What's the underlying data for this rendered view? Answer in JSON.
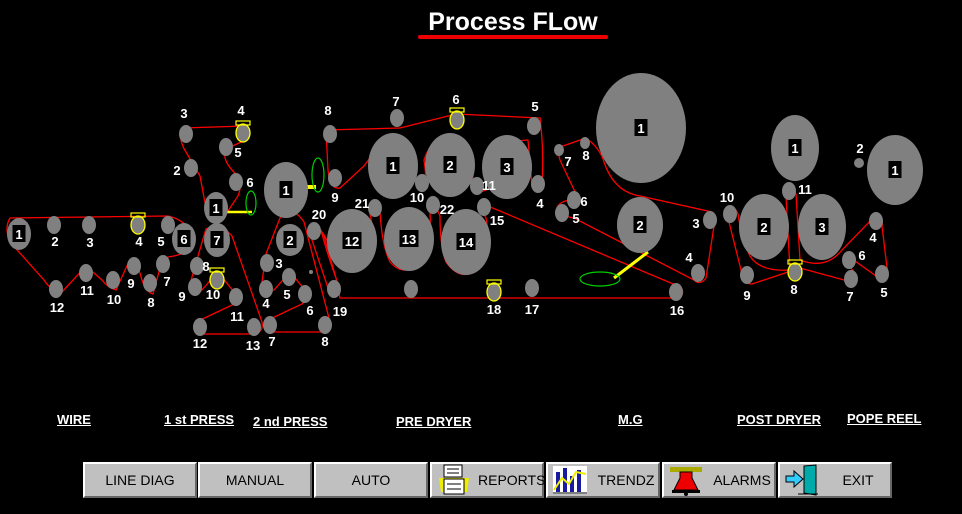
{
  "title": "Process FLow",
  "colors": {
    "felt": "#ff0000",
    "roll": "#808080",
    "accent": "#ffff00",
    "green": "#00cc00",
    "background": "#000000"
  },
  "sections": [
    {
      "id": "wire",
      "name": "WIRE",
      "rolls": [
        "1",
        "2",
        "3",
        "4",
        "5",
        "6",
        "7",
        "8",
        "9",
        "10",
        "11",
        "12"
      ]
    },
    {
      "id": "press1",
      "name": "1 st PRESS",
      "rolls": [
        "1",
        "2",
        "3",
        "4",
        "5",
        "6",
        "7",
        "8",
        "9",
        "10",
        "11",
        "12",
        "13"
      ]
    },
    {
      "id": "press2",
      "name": "2 nd PRESS",
      "rolls": [
        "1",
        "2",
        "3",
        "4",
        "5",
        "6",
        "7",
        "8"
      ]
    },
    {
      "id": "predryer",
      "name": "PRE DRYER",
      "rolls": [
        "1",
        "2",
        "3",
        "4",
        "5",
        "6",
        "7",
        "8",
        "9",
        "10",
        "11",
        "12",
        "13",
        "14",
        "15",
        "16",
        "17",
        "18",
        "19",
        "20",
        "21",
        "22",
        ""
      ]
    },
    {
      "id": "mg",
      "name": "M.G",
      "rolls": [
        "1",
        "2",
        "3",
        "4",
        "5",
        "6",
        "7",
        "8"
      ]
    },
    {
      "id": "postdryer",
      "name": "POST DRYER",
      "rolls": [
        "1",
        "2",
        "3",
        "4",
        "5",
        "6",
        "7",
        "8",
        "9",
        "10",
        "11"
      ]
    },
    {
      "id": "popereel",
      "name": "POPE REEL",
      "rolls": [
        "1",
        "2"
      ]
    }
  ],
  "buttons": [
    {
      "id": "line-diag",
      "label": "LINE DIAG",
      "icon": ""
    },
    {
      "id": "manual",
      "label": "MANUAL",
      "icon": ""
    },
    {
      "id": "auto",
      "label": "AUTO",
      "icon": ""
    },
    {
      "id": "reports",
      "label": "REPORTS",
      "icon": "report-printer-icon"
    },
    {
      "id": "trendz",
      "label": "TRENDZ",
      "icon": "trend-chart-icon"
    },
    {
      "id": "alarms",
      "label": "ALARMS",
      "icon": "alarm-bell-icon"
    },
    {
      "id": "exit",
      "label": "EXIT",
      "icon": "exit-door-icon"
    }
  ]
}
